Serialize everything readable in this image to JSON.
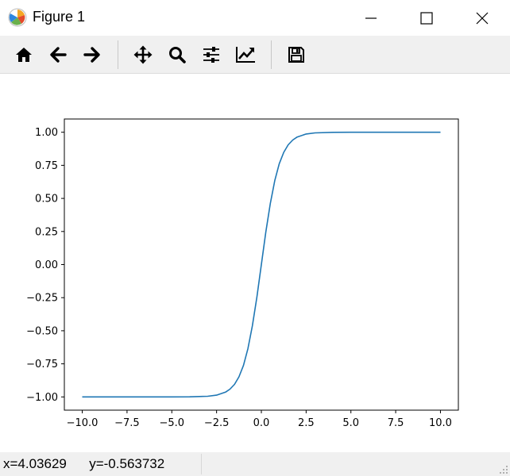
{
  "window": {
    "title": "Figure 1",
    "controls": [
      "minimize-icon",
      "maximize-icon",
      "close-icon"
    ]
  },
  "toolbar": {
    "buttons": [
      {
        "name": "home",
        "icon": "home-icon"
      },
      {
        "name": "back",
        "icon": "arrow-left-icon"
      },
      {
        "name": "forward",
        "icon": "arrow-right-icon"
      },
      {
        "name": "pan",
        "icon": "move-icon"
      },
      {
        "name": "zoom",
        "icon": "magnifier-icon"
      },
      {
        "name": "configure-subplots",
        "icon": "sliders-icon"
      },
      {
        "name": "edit-axis",
        "icon": "trend-chart-icon"
      },
      {
        "name": "save",
        "icon": "floppy-disk-icon"
      }
    ]
  },
  "status": {
    "text": "x=4.03629      y=-0.563732"
  },
  "chart_data": {
    "type": "line",
    "title": "",
    "xlabel": "",
    "ylabel": "",
    "xlim": [
      -11,
      11
    ],
    "ylim": [
      -1.1,
      1.1
    ],
    "grid": false,
    "x_ticks": [
      "−10.0",
      "−7.5",
      "−5.0",
      "−2.5",
      "0.0",
      "2.5",
      "5.0",
      "7.5",
      "10.0"
    ],
    "x_tick_values": [
      -10,
      -7.5,
      -5,
      -2.5,
      0,
      2.5,
      5,
      7.5,
      10
    ],
    "y_ticks": [
      "1.00",
      "0.75",
      "0.50",
      "0.25",
      "0.00",
      "−0.25",
      "−0.50",
      "−0.75",
      "−1.00"
    ],
    "y_tick_values": [
      1,
      0.75,
      0.5,
      0.25,
      0,
      -0.25,
      -0.5,
      -0.75,
      -1
    ],
    "series": [
      {
        "color": "#1f77b4",
        "x": [
          -10,
          -5,
          -4,
          -3,
          -2.5,
          -2,
          -1.75,
          -1.5,
          -1.25,
          -1,
          -0.75,
          -0.5,
          -0.25,
          0,
          0.25,
          0.5,
          0.75,
          1,
          1.25,
          1.5,
          1.75,
          2,
          2.5,
          3,
          4,
          5,
          10
        ],
        "y": [
          -1,
          -1,
          -0.999,
          -0.995,
          -0.987,
          -0.964,
          -0.941,
          -0.905,
          -0.848,
          -0.762,
          -0.635,
          -0.462,
          -0.245,
          0,
          0.245,
          0.462,
          0.635,
          0.762,
          0.848,
          0.905,
          0.941,
          0.964,
          0.987,
          0.995,
          0.999,
          1,
          1
        ]
      }
    ]
  }
}
